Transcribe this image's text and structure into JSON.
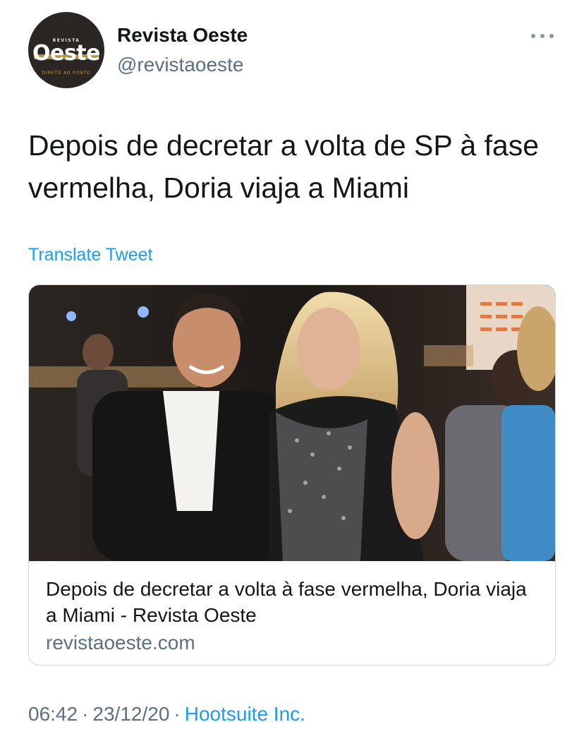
{
  "author": {
    "display_name": "Revista Oeste",
    "handle": "@revistaoeste",
    "avatar_logo": {
      "kicker": "REVISTA",
      "wordmark": "Oeste",
      "tagline": "DIRETO AO PONTO"
    }
  },
  "tweet": {
    "text": "Depois de decretar a volta de SP à fase vermelha, Doria viaja a Miami",
    "translate_label": "Translate Tweet"
  },
  "card": {
    "title": "Depois de decretar a volta à fase vermelha, Doria viaja a Miami - Revista Oeste",
    "domain": "revistaoeste.com"
  },
  "meta": {
    "time": "06:42",
    "date": "23/12/20",
    "separator": "·",
    "source": "Hootsuite Inc."
  },
  "colors": {
    "text_primary": "#14171a",
    "text_secondary": "#5b7083",
    "link": "#1d9bf0",
    "border": "#cfd9de",
    "logo_gold": "#c59a43"
  },
  "icons": [
    "more-horizontal-icon"
  ]
}
